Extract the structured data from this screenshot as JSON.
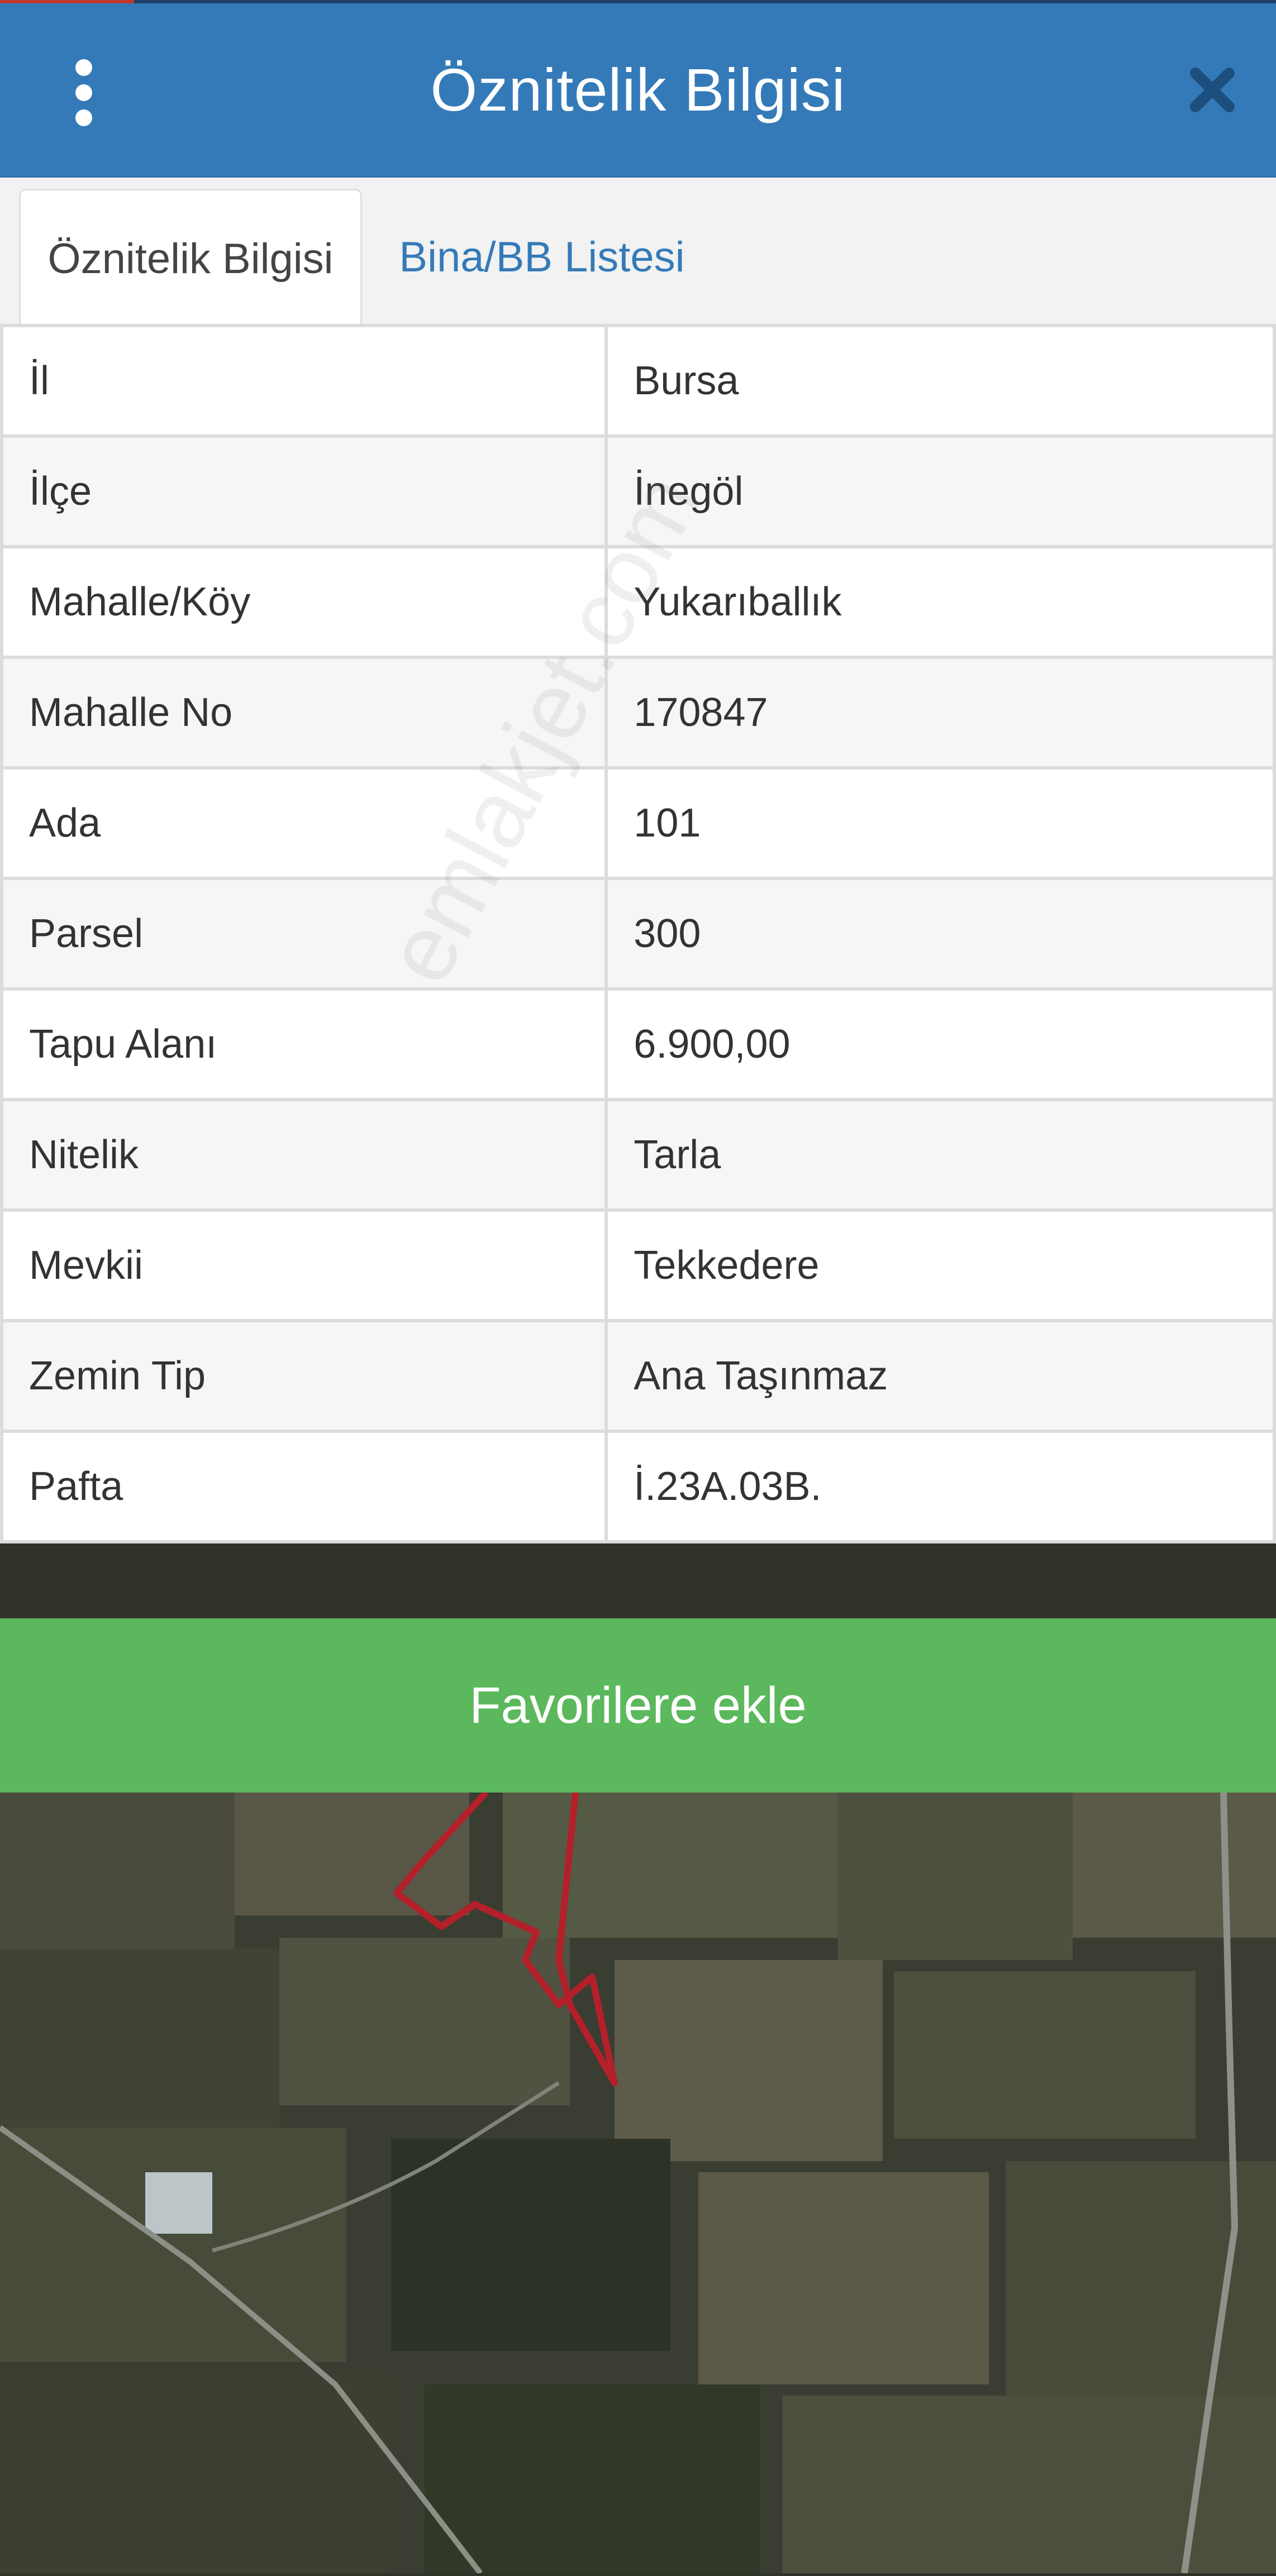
{
  "header": {
    "title": "Öznitelik Bilgisi"
  },
  "tabs": [
    {
      "label": "Öznitelik Bilgisi",
      "active": true
    },
    {
      "label": "Bina/BB Listesi",
      "active": false
    }
  ],
  "attributes": [
    {
      "key": "İl",
      "value": "Bursa"
    },
    {
      "key": "İlçe",
      "value": "İnegöl"
    },
    {
      "key": "Mahalle/Köy",
      "value": "Yukarıballık"
    },
    {
      "key": "Mahalle No",
      "value": "170847"
    },
    {
      "key": "Ada",
      "value": "101"
    },
    {
      "key": "Parsel",
      "value": "300"
    },
    {
      "key": "Tapu Alanı",
      "value": "6.900,00"
    },
    {
      "key": "Nitelik",
      "value": "Tarla"
    },
    {
      "key": "Mevkii",
      "value": "Tekkedere"
    },
    {
      "key": "Zemin Tip",
      "value": "Ana Taşınmaz"
    },
    {
      "key": "Pafta",
      "value": "İ.23A.03B."
    }
  ],
  "watermark": "emlakjet.com",
  "favorite_button": {
    "label": "Favorilere ekle"
  },
  "colors": {
    "header": "#347ab8",
    "tab_link": "#347ab8",
    "favorite_button": "#5cb85c",
    "parcel_outline": "#b3202a"
  },
  "icons": {
    "menu": "vertical-dots-icon",
    "close": "close-icon"
  }
}
